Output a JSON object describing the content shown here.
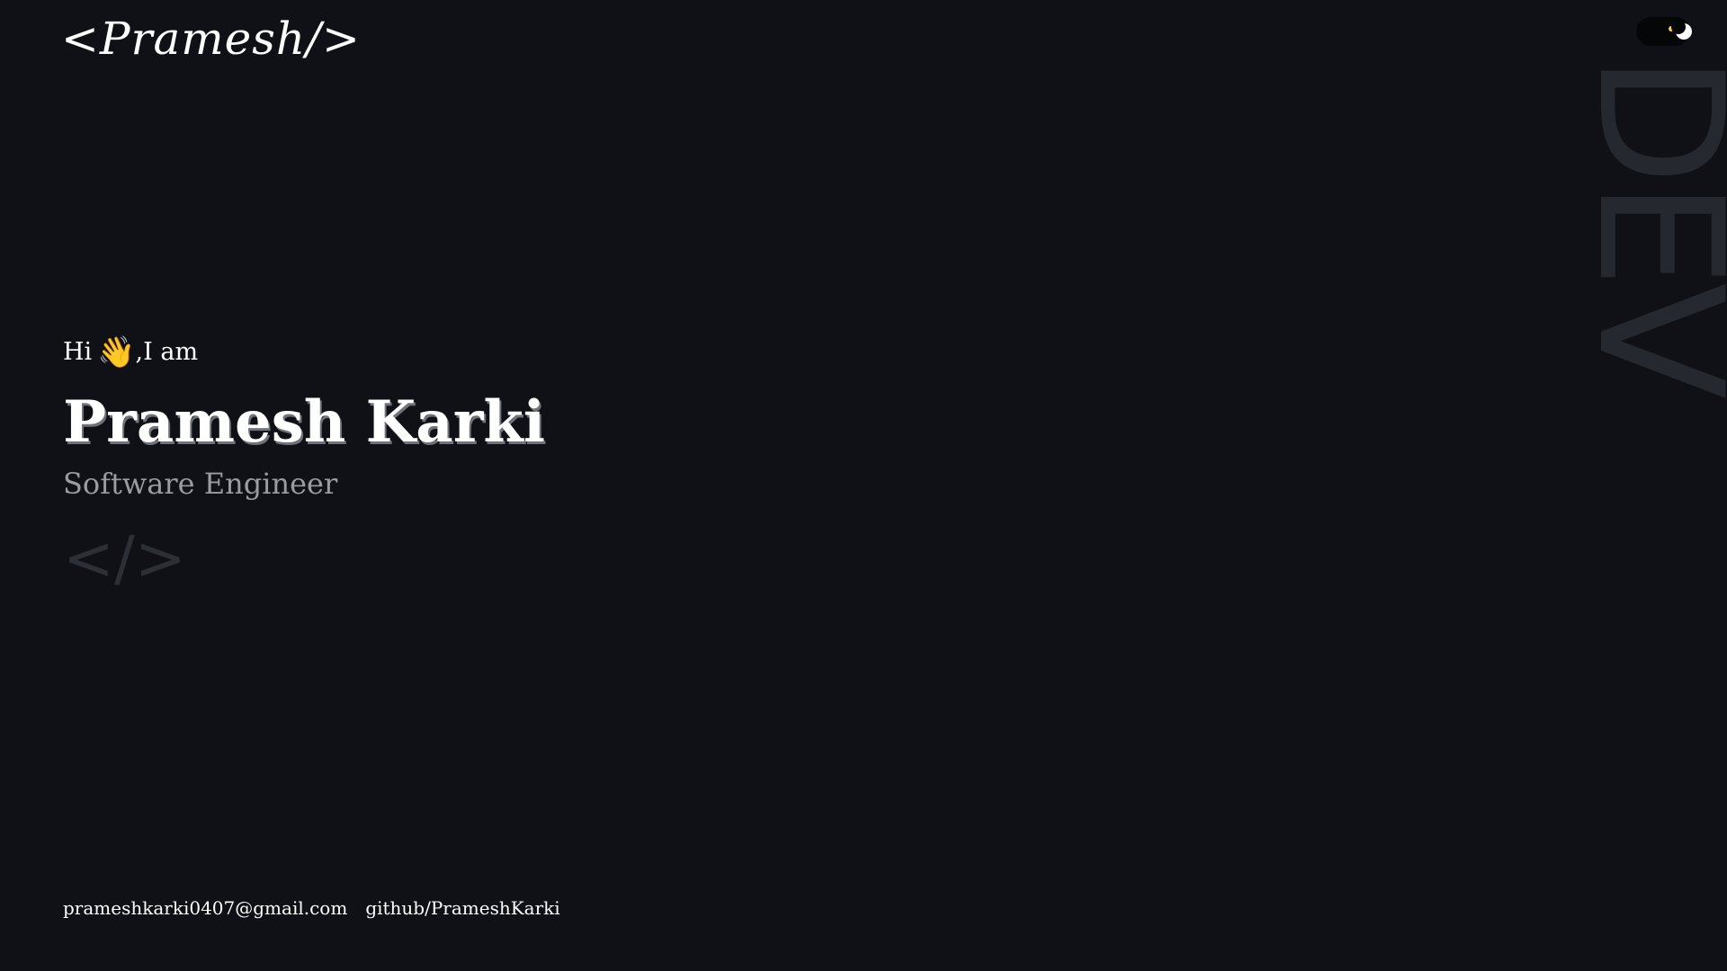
{
  "header": {
    "logo_text": "<Pramesh/>"
  },
  "theme_toggle": {
    "state": "dark",
    "icon": "moon-icon"
  },
  "side_text": "DEV",
  "hero": {
    "greeting_prefix": "Hi",
    "wave_icon": "waving-hand-icon",
    "greeting_suffix": ",I am",
    "name": "Pramesh Karki",
    "role": "Software Engineer",
    "code_symbol": "</>"
  },
  "footer": {
    "links": [
      {
        "label": "prameshkarki0407@gmail.com"
      },
      {
        "label": "github/PrameshKarki"
      }
    ]
  },
  "colors": {
    "background": "#0f1116",
    "text": "#ffffff",
    "muted": "#9a9ca0",
    "ghost": "#25282e"
  }
}
